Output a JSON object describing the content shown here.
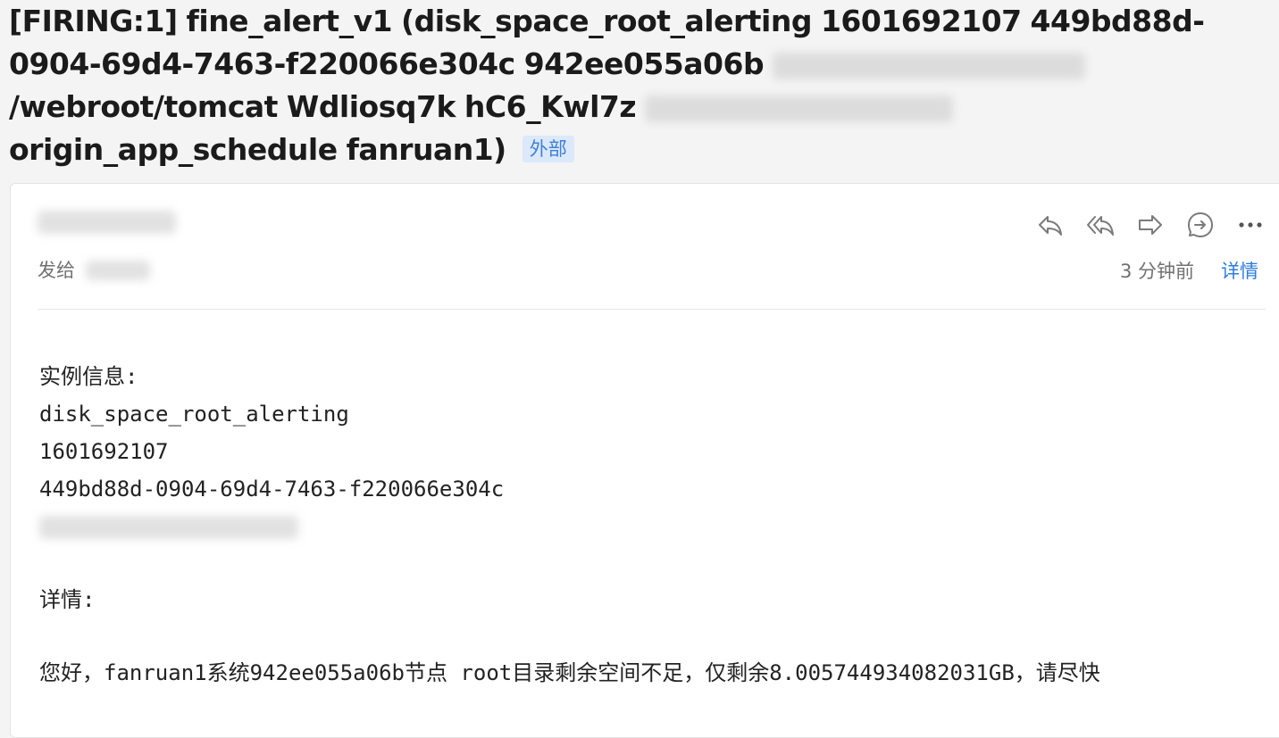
{
  "subject": {
    "line1": "[FIRING:1] fine_alert_v1 (disk_space_root_alerting 1601692107 449bd88d-",
    "line2": "0904-69d4-7463-f220066e304c 942ee055a06b",
    "line3": "/webroot/tomcat Wdliosq7k hC6_Kwl7z",
    "line4": "origin_app_schedule fanruan1)",
    "tag": "外部"
  },
  "header": {
    "to_label": "发给",
    "time": "3 分钟前",
    "details_link": "详情"
  },
  "toolbar": {
    "icons": [
      "reply-icon",
      "reply-all-icon",
      "forward-icon",
      "chat-icon",
      "more-icon"
    ]
  },
  "body": {
    "instance_label": "实例信息:",
    "alert_name": "disk_space_root_alerting",
    "timestamp": "1601692107",
    "uuid": "449bd88d-0904-69d4-7463-f220066e304c",
    "details_label": "详情:",
    "message": "您好，fanruan1系统942ee055a06b节点 root目录剩余空间不足，仅剩余8.005744934082031GB，请尽快"
  },
  "colors": {
    "accent": "#2e7cdc",
    "tag_bg": "#dbe9fb",
    "tag_text": "#3f7fd8"
  }
}
